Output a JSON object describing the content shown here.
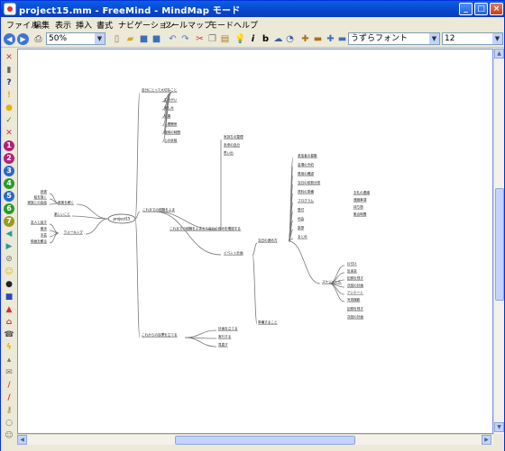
{
  "window": {
    "title": "project15.mm - FreeMind - MindMap モード"
  },
  "menu": [
    "ファイル",
    "編集",
    "表示",
    "挿入",
    "書式",
    "ナビゲーション",
    "ツール",
    "マップ",
    "モード",
    "ヘルプ"
  ],
  "toolbar": {
    "zoom": "50%",
    "font": "うずらフォント",
    "size": "12"
  },
  "left_icons": [
    "close-icon",
    "trash-icon",
    "question-icon",
    "warning-icon",
    "idea-icon",
    "ok-icon",
    "no-icon",
    "number-1-icon",
    "number-2-icon",
    "number-3-icon",
    "number-4-icon",
    "number-5-icon",
    "number-6-icon",
    "number-7-icon",
    "back-icon",
    "forward-icon",
    "attach-icon",
    "smiley-icon",
    "bomb-icon",
    "book-icon",
    "flag-icon",
    "home-icon",
    "phone-icon",
    "lightning-icon",
    "launch-icon",
    "mail-icon",
    "pencil-icon",
    "pen-icon",
    "key-icon",
    "zoom-icon",
    "person-icon"
  ],
  "mindmap": {
    "root": "project15",
    "left": {
      "main": [
        "楽しいこと",
        "ウォーキング",
        "音楽を聴く"
      ],
      "top": [
        "読書",
        "絵を描く",
        "家族との会話"
      ],
      "bottom": [
        "友人と話す",
        "散歩",
        "手芸",
        "映画を観る"
      ]
    },
    "right": {
      "top": [
        "自分にとって大切なこと",
        "生きがい",
        "楽しみ",
        "健康",
        "人間関係",
        "趣味の時間",
        "心の余裕"
      ],
      "middle": [
        "これまでの経験をふまえて自分の強みを確認する",
        "気持ちの整理",
        "未来の自分",
        "イベント計画",
        "当日の進め方",
        "準備すること",
        "スケジュール"
      ],
      "right": [
        "参加者の募集",
        "会場の予約",
        "費用の確認",
        "当日の役割分担",
        "資料の準備",
        "プログラム",
        "受付",
        "司会",
        "挨拶",
        "まとめ",
        "片付け",
        "反省会",
        "記録を残す",
        "次回の計画",
        "アンケート",
        "写真撮影",
        "お礼の連絡",
        "連絡事項",
        "持ち物",
        "集合時間"
      ],
      "bottom": [
        "これからの目標を立てる",
        "計画を立てる",
        "実行する",
        "見直す"
      ]
    }
  }
}
